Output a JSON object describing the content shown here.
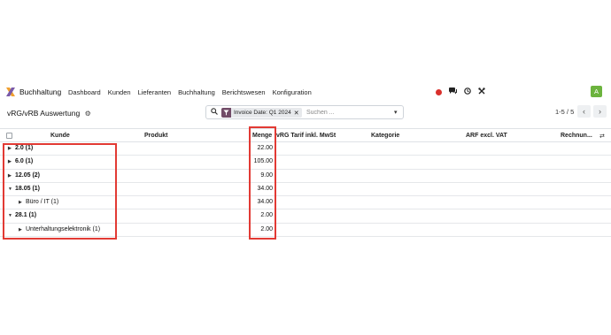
{
  "navbar": {
    "app_name": "Buchhaltung",
    "menu": [
      "Dashboard",
      "Kunden",
      "Lieferanten",
      "Buchhaltung",
      "Berichtswesen",
      "Konfiguration"
    ],
    "avatar_letter": "A",
    "record_color": "#d9302c",
    "avatar_color": "#6cb33e"
  },
  "control_panel": {
    "title": "vRG/vRB Auswertung",
    "facet_label": "Invoice Date: Q1 2024",
    "search_placeholder": "Suchen ...",
    "pager": "1-5 / 5"
  },
  "table": {
    "columns": [
      "Kunde",
      "Produkt",
      "Menge",
      "vRG Tarif inkl. MwSt",
      "Kategorie",
      "ARF excl. VAT",
      "Rechnun..."
    ],
    "rows": [
      {
        "label": "2.0 (1)",
        "menge": "22.00",
        "level": 0,
        "expanded": false
      },
      {
        "label": "6.0 (1)",
        "menge": "105.00",
        "level": 0,
        "expanded": false
      },
      {
        "label": "12.05 (2)",
        "menge": "9.00",
        "level": 0,
        "expanded": false
      },
      {
        "label": "18.05 (1)",
        "menge": "34.00",
        "level": 0,
        "expanded": true
      },
      {
        "label": "Büro / IT (1)",
        "menge": "34.00",
        "level": 1,
        "expanded": false
      },
      {
        "label": "28.1 (1)",
        "menge": "2.00",
        "level": 0,
        "expanded": true
      },
      {
        "label": "Unterhaltungselektronik (1)",
        "menge": "2.00",
        "level": 1,
        "expanded": false
      }
    ]
  },
  "highlight_color": "#e23a34"
}
